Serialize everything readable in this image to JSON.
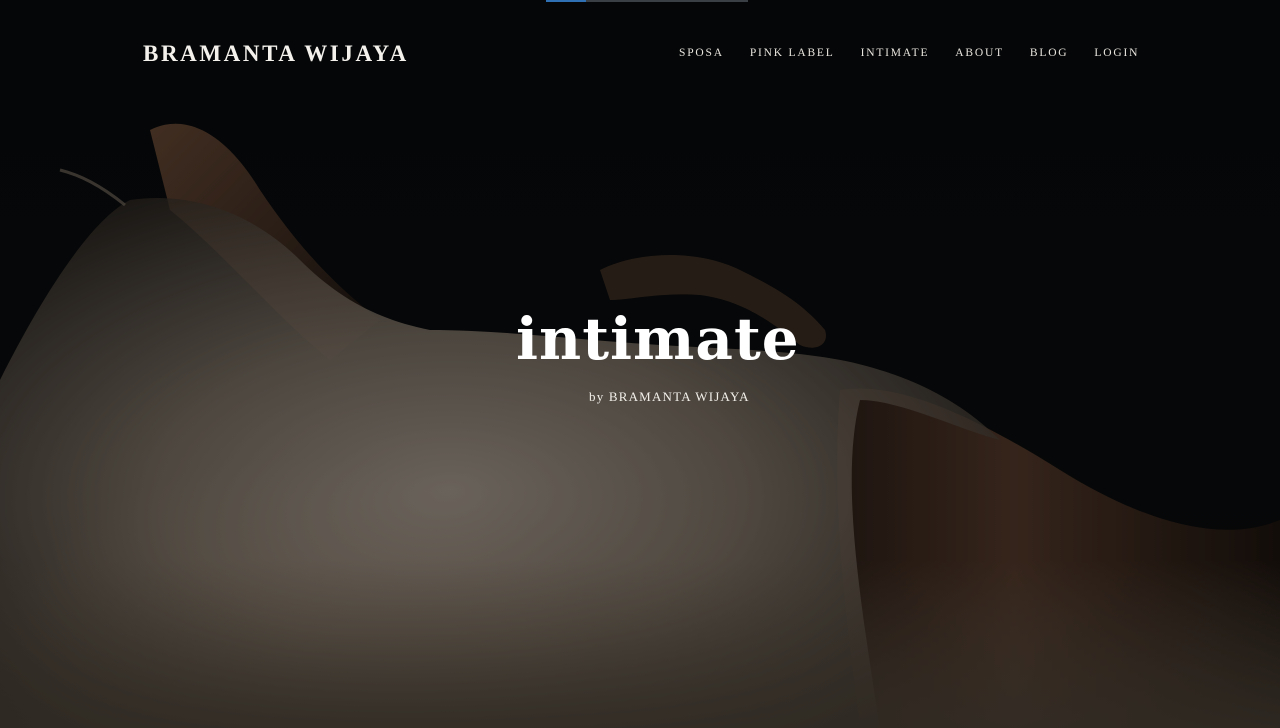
{
  "header": {
    "brand": "BRAMANTA WIJAYA",
    "nav": [
      {
        "label": "SPOSA"
      },
      {
        "label": "PINK LABEL"
      },
      {
        "label": "INTIMATE"
      },
      {
        "label": "ABOUT"
      },
      {
        "label": "BLOG"
      },
      {
        "label": "LOGIN"
      }
    ]
  },
  "hero": {
    "title": "intimate",
    "subtitle": "by BRAMANTA WIJAYA"
  },
  "colors": {
    "background": "#050607",
    "text": "#ffffff",
    "accent_bar": "#2f6fb3"
  }
}
